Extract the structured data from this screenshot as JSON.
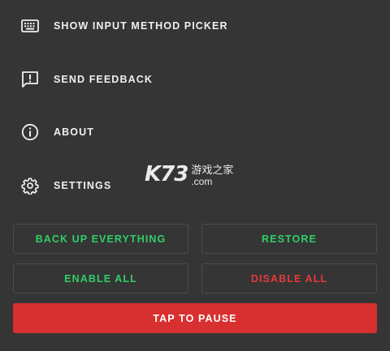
{
  "menu": {
    "items": [
      {
        "label": "SHOW INPUT METHOD PICKER",
        "icon": "keyboard-icon"
      },
      {
        "label": "SEND FEEDBACK",
        "icon": "feedback-icon"
      },
      {
        "label": "ABOUT",
        "icon": "info-icon"
      },
      {
        "label": "SETTINGS",
        "icon": "gear-icon"
      }
    ]
  },
  "buttons": {
    "backup": "BACK UP EVERYTHING",
    "restore": "RESTORE",
    "enable_all": "ENABLE ALL",
    "disable_all": "DISABLE ALL",
    "tap_to_pause": "TAP TO PAUSE"
  },
  "watermark": {
    "main": "K73",
    "cn": "游戏之家",
    "domain": ".com"
  },
  "colors": {
    "background": "#353535",
    "green": "#2fcf68",
    "red": "#e5393b",
    "pause_bg": "#d83030"
  }
}
